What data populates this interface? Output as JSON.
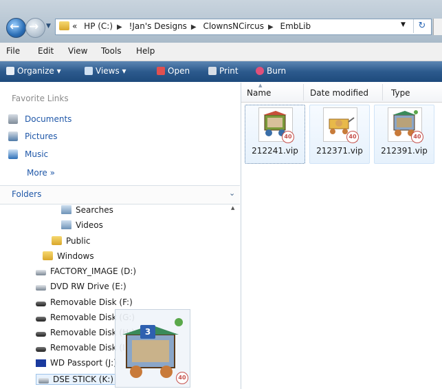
{
  "address": {
    "overflow": "«",
    "crumbs": [
      "HP (C:)",
      "!Jan's Designs",
      "ClownsNCircus",
      "EmbLib"
    ]
  },
  "menu": [
    "File",
    "Edit",
    "View",
    "Tools",
    "Help"
  ],
  "toolbar": {
    "organize": "Organize",
    "views": "Views",
    "open": "Open",
    "print": "Print",
    "burn": "Burn"
  },
  "nav": {
    "favorites_title": "Favorite Links",
    "favorites": [
      "Documents",
      "Pictures",
      "Music"
    ],
    "more": "More »",
    "folders_label": "Folders",
    "tree": [
      "Searches",
      "Videos",
      "Public",
      "Windows",
      "FACTORY_IMAGE (D:)",
      "DVD RW Drive (E:)",
      "Removable Disk (F:)",
      "Removable Disk (G:)",
      "Removable Disk (H:)",
      "Removable Disk (I:)",
      "WD Passport (J:)",
      "DSE STICK (K:)"
    ]
  },
  "content": {
    "columns": [
      "Name",
      "Date modified",
      "Type"
    ],
    "files": [
      {
        "name": "212241.vip",
        "badge": "40"
      },
      {
        "name": "212371.vip",
        "badge": "40"
      },
      {
        "name": "212391.vip",
        "badge": "40"
      }
    ]
  },
  "drag": {
    "count": "3",
    "badge": "40"
  },
  "colors": {
    "toolbar": "#2c5a8d",
    "link": "#1f57a8",
    "selection": "#e6f1fc"
  }
}
